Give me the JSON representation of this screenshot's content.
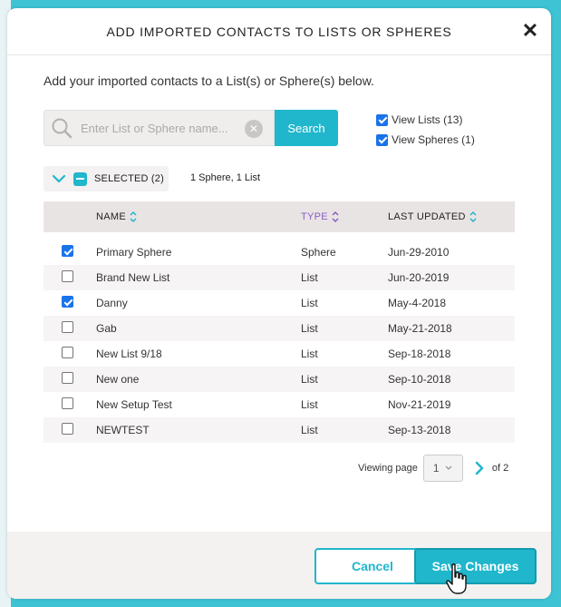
{
  "modal": {
    "title": "ADD IMPORTED CONTACTS TO LISTS OR SPHERES",
    "intro": "Add your imported contacts to a List(s) or Sphere(s) below."
  },
  "search": {
    "placeholder": "Enter List or Sphere name...",
    "button_label": "Search"
  },
  "filters": {
    "view_lists": {
      "label": "View Lists (13)",
      "checked": true
    },
    "view_spheres": {
      "label": "View Spheres (1)",
      "checked": true
    }
  },
  "selection": {
    "label": "SELECTED (2)",
    "summary": "1 Sphere, 1 List"
  },
  "table": {
    "columns": [
      "NAME",
      "TYPE",
      "LAST UPDATED"
    ],
    "rows": [
      {
        "checked": true,
        "name": "Primary Sphere",
        "type": "Sphere",
        "updated": "Jun-29-2010"
      },
      {
        "checked": false,
        "name": "Brand New List",
        "type": "List",
        "updated": "Jun-20-2019"
      },
      {
        "checked": true,
        "name": "Danny",
        "type": "List",
        "updated": "May-4-2018"
      },
      {
        "checked": false,
        "name": "Gab",
        "type": "List",
        "updated": "May-21-2018"
      },
      {
        "checked": false,
        "name": "New List 9/18",
        "type": "List",
        "updated": "Sep-18-2018"
      },
      {
        "checked": false,
        "name": "New one",
        "type": "List",
        "updated": "Sep-10-2018"
      },
      {
        "checked": false,
        "name": "New Setup Test",
        "type": "List",
        "updated": "Nov-21-2019"
      },
      {
        "checked": false,
        "name": "NEWTEST",
        "type": "List",
        "updated": "Sep-13-2018"
      }
    ]
  },
  "pager": {
    "viewing_label": "Viewing page",
    "current": "1",
    "of_label": "of 2"
  },
  "footer": {
    "cancel_label": "Cancel",
    "save_label": "Save Changes"
  },
  "colors": {
    "accent": "#20b6cc",
    "background": "#3ec3d5",
    "type_header": "#8a5cc7"
  }
}
